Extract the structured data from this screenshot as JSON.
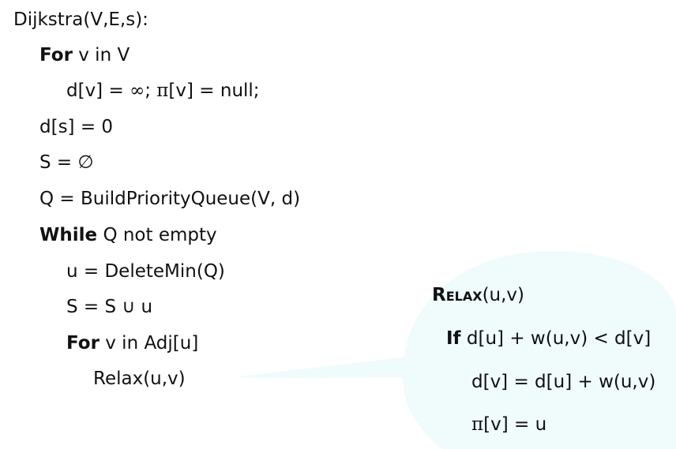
{
  "pseudocode": {
    "header": "Dijkstra(V,E,s):",
    "for_kw": "For",
    "for_rest": "v in V",
    "init_a": "d[v] = ",
    "infinity": "∞",
    "init_b": "; ",
    "pi": "π",
    "init_c": "[v] = null;",
    "ds": "d[s] = 0",
    "s_init_a": "S = ",
    "emptyset": "∅",
    "q_build": "Q = BuildPriorityQueue(V, d)",
    "while_kw": "While",
    "while_rest": "Q not empty",
    "deletemin": "u = DeleteMin(Q)",
    "s_union": "S = S ∪ u",
    "for2_kw": "For",
    "for2_rest": "v in Adj[u]",
    "relax_call": "Relax(u,v)"
  },
  "relax_box": {
    "title_kw": "Relax",
    "title_rest": "(u,v)",
    "if_kw": "If",
    "if_rest": "d[u] + w(u,v) < d[v]",
    "assign": "d[v] = d[u] + w(u,v)",
    "pi": "π",
    "pi_rest": "[v] = u",
    "bubble_color": "#f0fbfc"
  }
}
